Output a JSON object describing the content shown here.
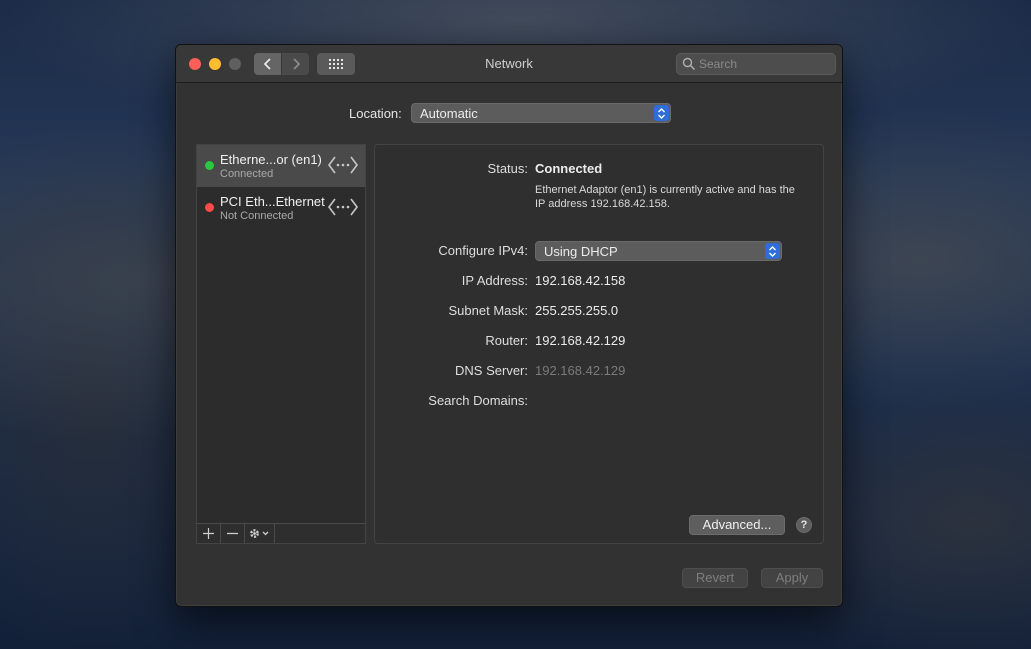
{
  "window": {
    "title": "Network"
  },
  "search": {
    "placeholder": "Search"
  },
  "location": {
    "label": "Location:",
    "value": "Automatic"
  },
  "services": [
    {
      "name": "Etherne...or (en1)",
      "status": "Connected",
      "status_color": "#28c840",
      "selected": true
    },
    {
      "name": "PCI Eth...Ethernet",
      "status": "Not Connected",
      "status_color": "#ff4a4a",
      "selected": false
    }
  ],
  "sidebar_toolbar": {
    "add": "+",
    "remove": "−"
  },
  "detail": {
    "status_label": "Status:",
    "status_value": "Connected",
    "status_desc": "Ethernet Adaptor (en1) is currently active and has the IP address 192.168.42.158.",
    "configure_label": "Configure IPv4:",
    "configure_value": "Using DHCP",
    "ip_label": "IP Address:",
    "ip_value": "192.168.42.158",
    "subnet_label": "Subnet Mask:",
    "subnet_value": "255.255.255.0",
    "router_label": "Router:",
    "router_value": "192.168.42.129",
    "dns_label": "DNS Server:",
    "dns_value": "192.168.42.129",
    "search_domains_label": "Search Domains:",
    "search_domains_value": "",
    "advanced_label": "Advanced...",
    "help_label": "?"
  },
  "buttons": {
    "revert": "Revert",
    "apply": "Apply"
  },
  "colors": {
    "accent": "#2f6ed9",
    "close": "#fe5f57",
    "minimize": "#febc2e"
  }
}
